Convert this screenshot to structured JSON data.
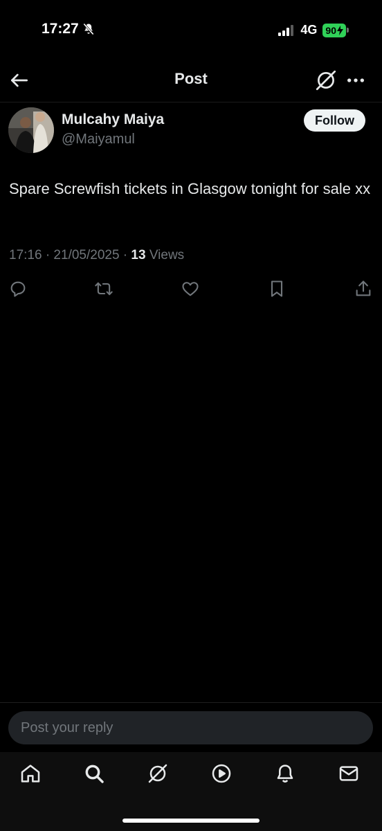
{
  "status_bar": {
    "time": "17:27",
    "network": "4G",
    "battery": "90"
  },
  "header": {
    "title": "Post"
  },
  "post": {
    "author_name": "Mulcahy Maiya",
    "author_handle": "@Maiyamul",
    "follow_label": "Follow",
    "text": "Spare Screwfish tickets in Glasgow tonight for sale xx",
    "timestamp": "17:16 · 21/05/2025 · ",
    "views_count": "13",
    "views_label": " Views"
  },
  "reply": {
    "placeholder": "Post your reply"
  },
  "colors": {
    "background": "#000000",
    "text_primary": "#e7e9ea",
    "text_secondary": "#71767b",
    "battery_green": "#30d158",
    "follow_button_bg": "#eff3f4"
  },
  "icons": {
    "header": [
      "back-arrow-icon",
      "grok-icon",
      "more-icon"
    ],
    "actions": [
      "reply-icon",
      "repost-icon",
      "like-icon",
      "bookmark-icon",
      "share-icon"
    ],
    "nav": [
      "home-icon",
      "search-icon",
      "grok-icon",
      "video-icon",
      "notifications-icon",
      "messages-icon"
    ]
  }
}
